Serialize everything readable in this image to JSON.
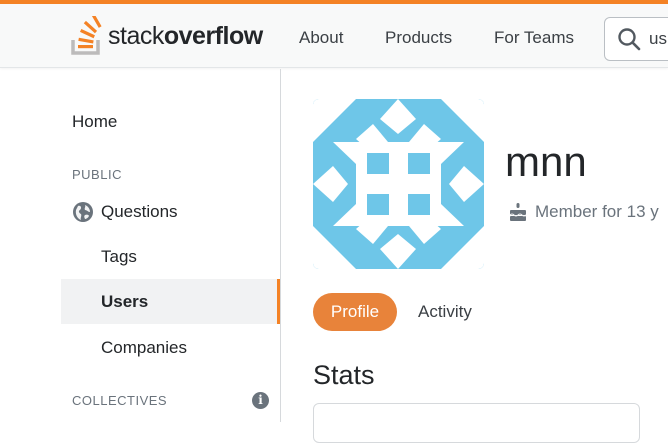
{
  "header": {
    "logo": {
      "word1": "stack",
      "word2": "overflow"
    },
    "nav": [
      "About",
      "Products",
      "For Teams"
    ],
    "search": {
      "value": "us",
      "icon": "search-icon"
    },
    "accent_color": "#f48225"
  },
  "sidebar": {
    "home": "Home",
    "public_heading": "PUBLIC",
    "questions": "Questions",
    "tags": "Tags",
    "users": "Users",
    "companies": "Companies",
    "collectives_heading": "COLLECTIVES",
    "active_item": "Users"
  },
  "profile": {
    "username": "mnn",
    "member_since": "Member for 13 y",
    "avatar_color": "#6ec6e8",
    "tabs": {
      "profile": "Profile",
      "activity": "Activity"
    },
    "active_tab_color": "#e8833a",
    "stats_heading": "Stats"
  }
}
